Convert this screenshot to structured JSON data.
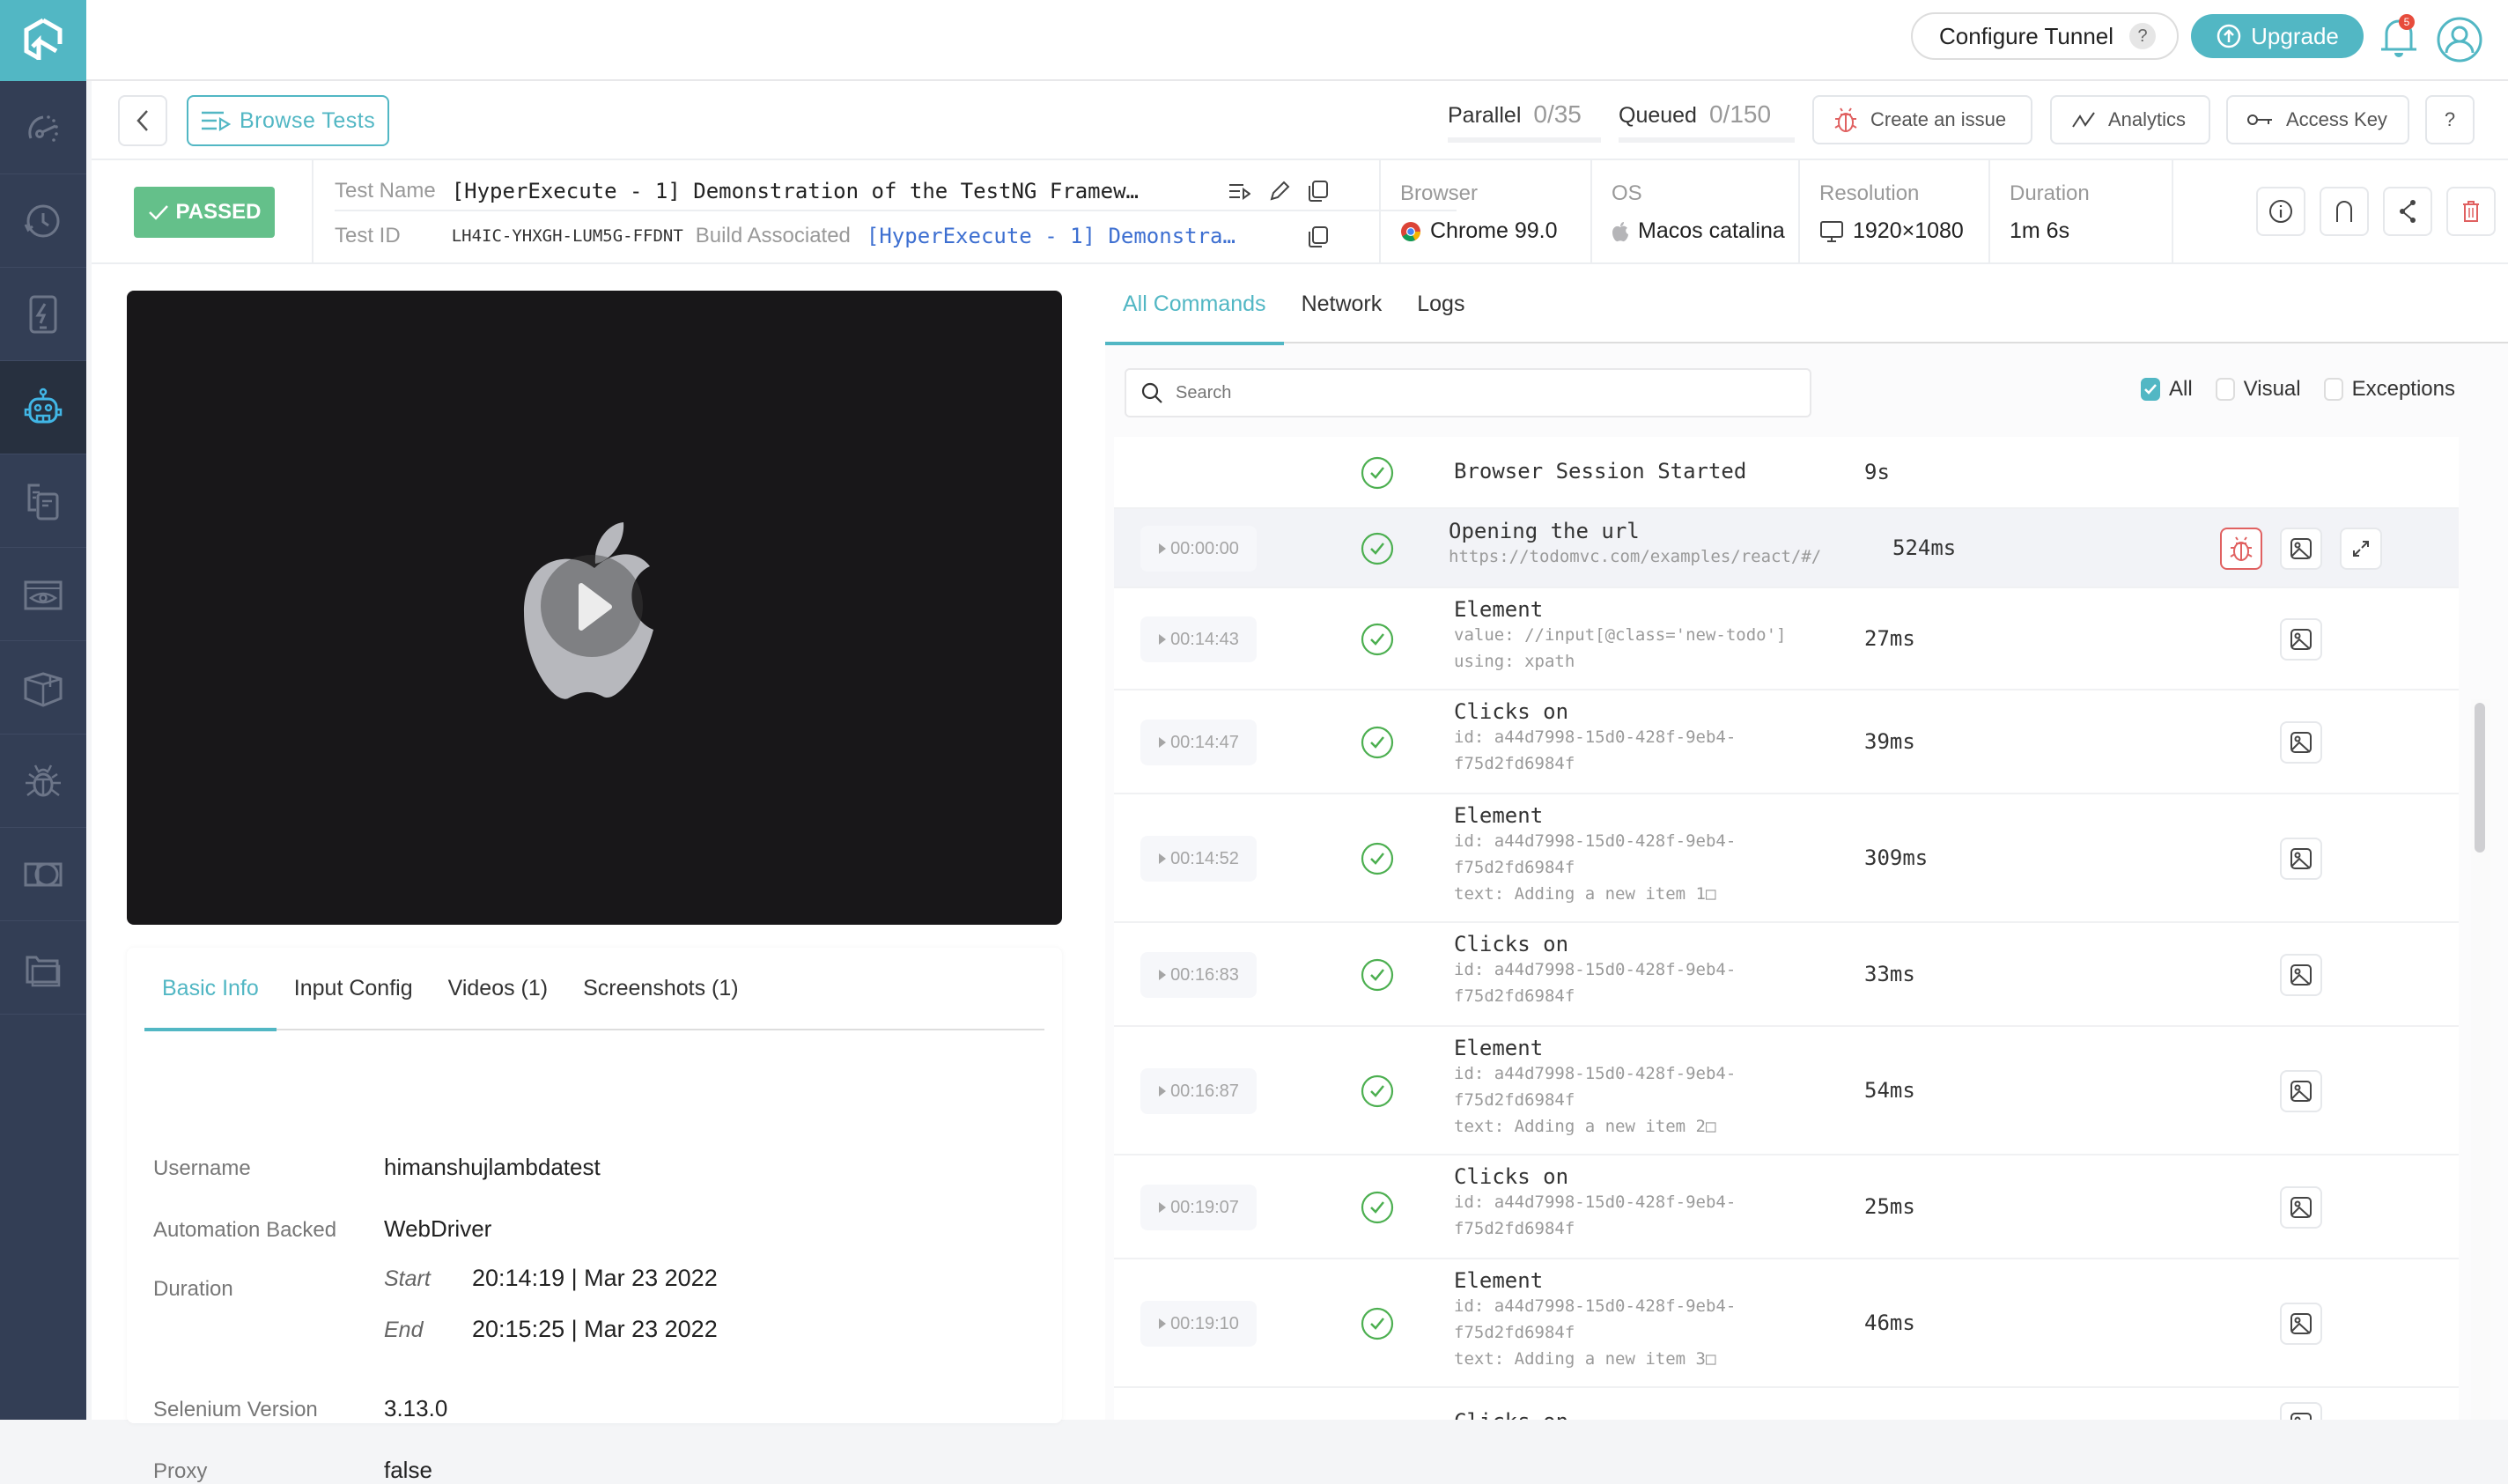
{
  "sidebar": {
    "items": [
      {
        "name": "dashboard",
        "icon": "speedometer-icon",
        "active": false
      },
      {
        "name": "real-time",
        "icon": "clock-refresh-icon",
        "active": false
      },
      {
        "name": "app-live",
        "icon": "mobile-bolt-icon",
        "active": false
      },
      {
        "name": "automation",
        "icon": "robot-icon",
        "active": true
      },
      {
        "name": "devices",
        "icon": "devices-icon",
        "active": false
      },
      {
        "name": "visual-ui",
        "icon": "browser-eye-icon",
        "active": false
      },
      {
        "name": "integrations",
        "icon": "box-icon",
        "active": false
      },
      {
        "name": "issue-tracker",
        "icon": "bug-icon",
        "active": false
      },
      {
        "name": "smart-ui",
        "icon": "compare-icon",
        "active": false
      },
      {
        "name": "files",
        "icon": "folders-icon",
        "active": false
      }
    ]
  },
  "topbar": {
    "configure_tunnel": "Configure Tunnel",
    "tunnel_help": "?",
    "upgrade": "Upgrade",
    "notification_count": "5"
  },
  "toolbar": {
    "browse_tests": "Browse Tests",
    "parallel_label": "Parallel",
    "parallel_value": "0/35",
    "queued_label": "Queued",
    "queued_value": "0/150",
    "create_issue": "Create an issue",
    "analytics": "Analytics",
    "access_key": "Access Key",
    "help": "?"
  },
  "test": {
    "status": "PASSED",
    "name_label": "Test Name",
    "name": "[HyperExecute - 1] Demonstration of the TestNG Framew…",
    "id_label": "Test ID",
    "id": "LH4IC-YHXGH-LUM5G-FFDNT",
    "build_label": "Build Associated",
    "build": "[HyperExecute - 1] Demonstra…",
    "browser_label": "Browser",
    "browser": "Chrome 99.0",
    "os_label": "OS",
    "os": "Macos catalina",
    "resolution_label": "Resolution",
    "resolution": "1920×1080",
    "duration_label": "Duration",
    "duration": "1m 6s"
  },
  "info_panel": {
    "tabs": [
      "Basic Info",
      "Input Config",
      "Videos (1)",
      "Screenshots (1)"
    ],
    "active_tab": "Basic Info",
    "username_label": "Username",
    "username": "himanshujlambdatest",
    "automation_label": "Automation Backed",
    "automation": "WebDriver",
    "duration_label": "Duration",
    "start_label": "Start",
    "start": "20:14:19 | Mar 23 2022",
    "end_label": "End",
    "end": "20:15:25 | Mar 23 2022",
    "selenium_label": "Selenium Version",
    "selenium": "3.13.0",
    "proxy_label": "Proxy",
    "proxy": "false"
  },
  "commands": {
    "tabs": [
      "All Commands",
      "Network",
      "Logs"
    ],
    "active_tab": "All Commands",
    "search_placeholder": "Search",
    "filters": [
      {
        "label": "All",
        "checked": true
      },
      {
        "label": "Visual",
        "checked": false
      },
      {
        "label": "Exceptions",
        "checked": false
      }
    ],
    "rows": [
      {
        "time": "",
        "title": "Browser Session Started",
        "sub": [],
        "duration": "9s",
        "buttons": []
      },
      {
        "time": "00:00:00",
        "title": "Opening the url",
        "sub": [
          "https://todomvc.com/examples/react/#/"
        ],
        "duration": "524ms",
        "buttons": [
          "bug",
          "image",
          "expand"
        ],
        "highlight": true
      },
      {
        "time": "00:14:43",
        "title": "Element",
        "sub": [
          "value: //input[@class='new-todo']",
          "using: xpath"
        ],
        "duration": "27ms",
        "buttons": [
          "image"
        ]
      },
      {
        "time": "00:14:47",
        "title": "Clicks on",
        "sub": [
          "id: a44d7998-15d0-428f-9eb4-",
          "f75d2fd6984f"
        ],
        "duration": "39ms",
        "buttons": [
          "image"
        ]
      },
      {
        "time": "00:14:52",
        "title": "Element",
        "sub": [
          "id: a44d7998-15d0-428f-9eb4-",
          "f75d2fd6984f",
          "text: Adding a new item 1□"
        ],
        "duration": "309ms",
        "buttons": [
          "image"
        ]
      },
      {
        "time": "00:16:83",
        "title": "Clicks on",
        "sub": [
          "id: a44d7998-15d0-428f-9eb4-",
          "f75d2fd6984f"
        ],
        "duration": "33ms",
        "buttons": [
          "image"
        ]
      },
      {
        "time": "00:16:87",
        "title": "Element",
        "sub": [
          "id: a44d7998-15d0-428f-9eb4-",
          "f75d2fd6984f",
          "text: Adding a new item 2□"
        ],
        "duration": "54ms",
        "buttons": [
          "image"
        ]
      },
      {
        "time": "00:19:07",
        "title": "Clicks on",
        "sub": [
          "id: a44d7998-15d0-428f-9eb4-",
          "f75d2fd6984f"
        ],
        "duration": "25ms",
        "buttons": [
          "image"
        ]
      },
      {
        "time": "00:19:10",
        "title": "Element",
        "sub": [
          "id: a44d7998-15d0-428f-9eb4-",
          "f75d2fd6984f",
          "text: Adding a new item 3□"
        ],
        "duration": "46ms",
        "buttons": [
          "image"
        ]
      },
      {
        "time": "",
        "title": "Clicks on",
        "sub": [],
        "duration": "",
        "buttons": [
          "image"
        ]
      }
    ]
  },
  "colors": {
    "accent": "#52b7c4",
    "sidebar": "#333e55",
    "passed": "#64c08a",
    "danger": "#e06161",
    "link": "#3d6fd1",
    "success_icon": "#4caf50"
  }
}
